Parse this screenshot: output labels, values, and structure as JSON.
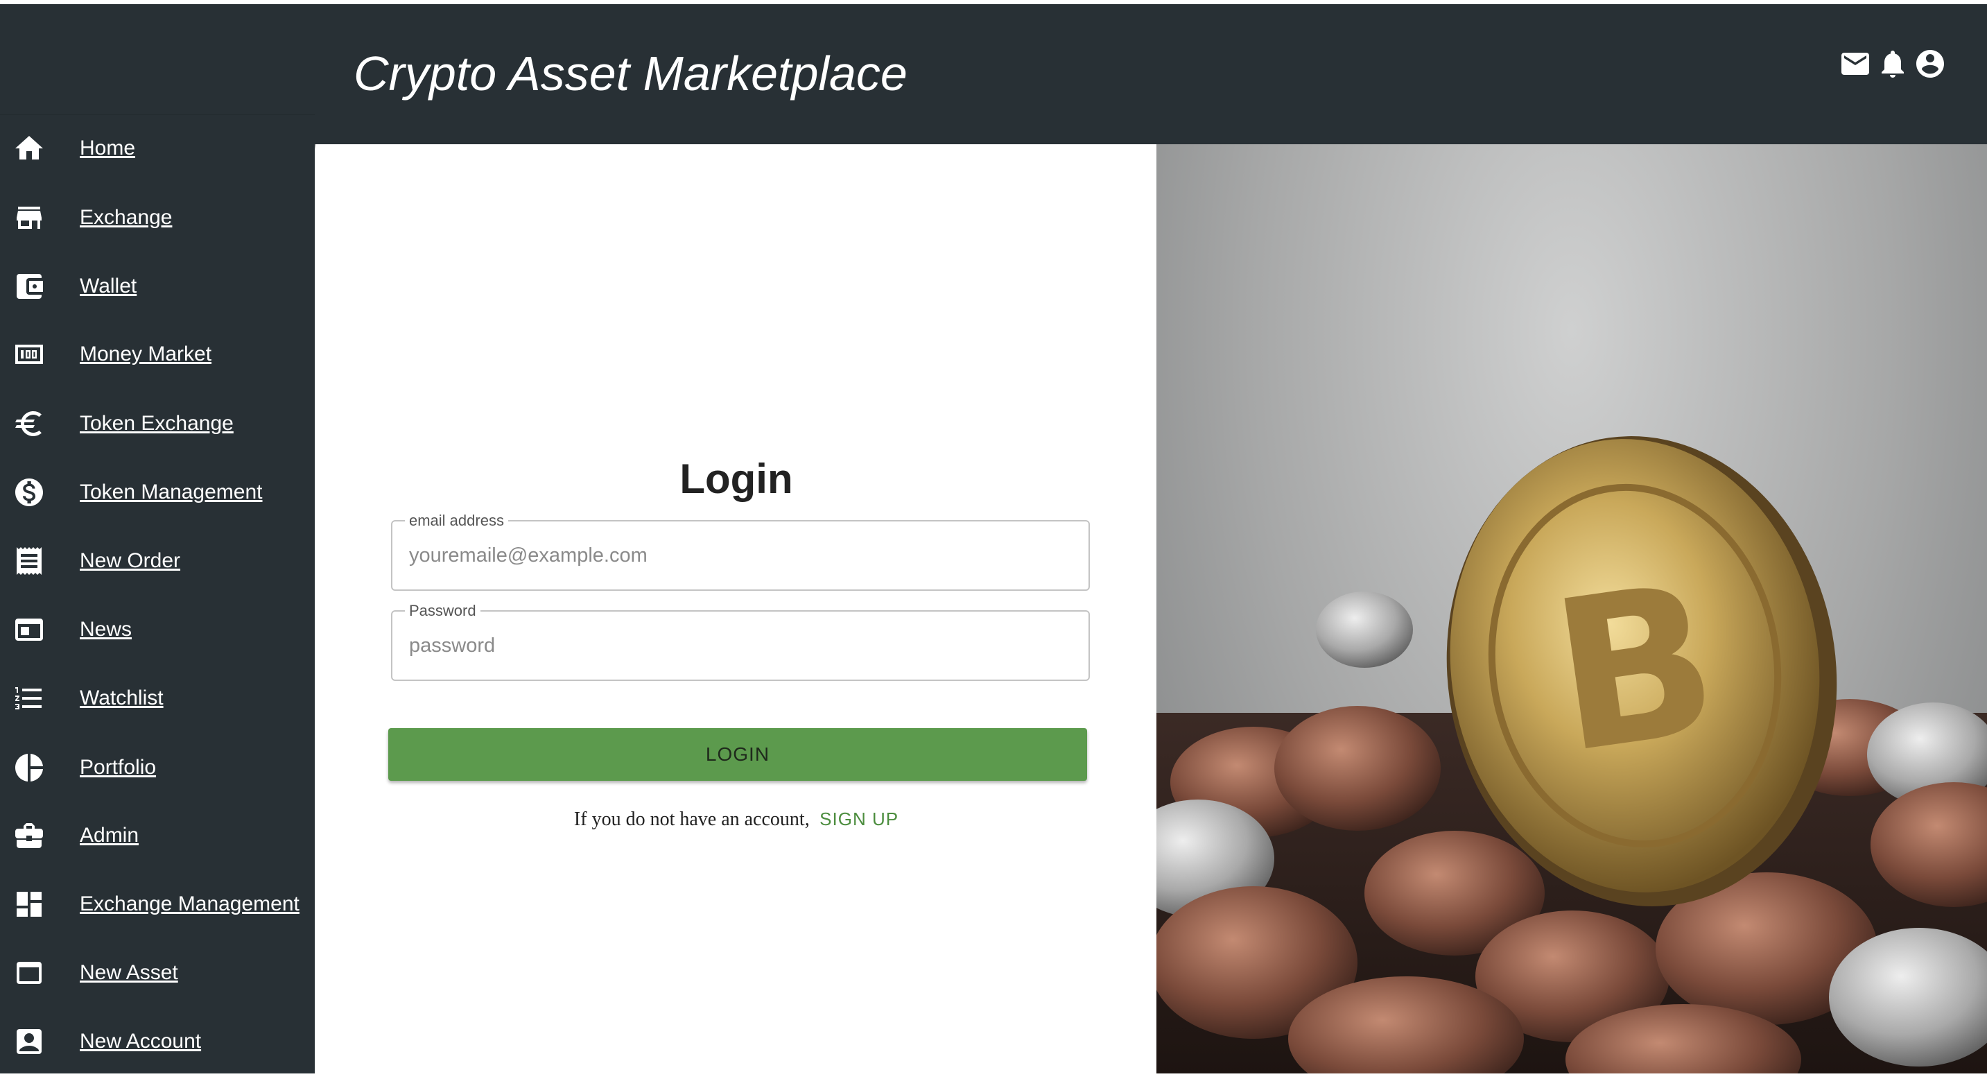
{
  "header": {
    "title": "Crypto Asset Marketplace",
    "icons": [
      "mail-icon",
      "bell-icon",
      "account-circle-icon"
    ]
  },
  "sidebar": {
    "items": [
      {
        "label": "Home",
        "icon": "home-icon"
      },
      {
        "label": "Exchange",
        "icon": "store-icon"
      },
      {
        "label": "Wallet",
        "icon": "wallet-icon"
      },
      {
        "label": "Money Market",
        "icon": "money-icon"
      },
      {
        "label": "Token Exchange",
        "icon": "euro-icon"
      },
      {
        "label": "Token Management",
        "icon": "dollar-circle-icon"
      },
      {
        "label": "New Order",
        "icon": "receipt-icon"
      },
      {
        "label": "News",
        "icon": "news-card-icon"
      },
      {
        "label": "Watchlist",
        "icon": "numbered-list-icon"
      },
      {
        "label": "Portfolio",
        "icon": "pie-chart-icon"
      },
      {
        "label": "Admin",
        "icon": "briefcase-icon"
      },
      {
        "label": "Exchange Management",
        "icon": "dashboard-icon"
      },
      {
        "label": "New Asset",
        "icon": "window-icon"
      },
      {
        "label": "New Account",
        "icon": "contact-card-icon"
      }
    ]
  },
  "login": {
    "title": "Login",
    "email_label": "email address",
    "email_placeholder": "youremaile@example.com",
    "email_value": "",
    "password_label": "Password",
    "password_placeholder": "password",
    "password_value": "",
    "button_label": "LOGIN",
    "signup_prompt": "If you do not have an account,",
    "signup_link": "SIGN UP"
  },
  "colors": {
    "sidebar_bg": "#283035",
    "header_bg": "#283035",
    "accent_green": "#5c9a4d",
    "link_green": "#4c8d3e"
  }
}
